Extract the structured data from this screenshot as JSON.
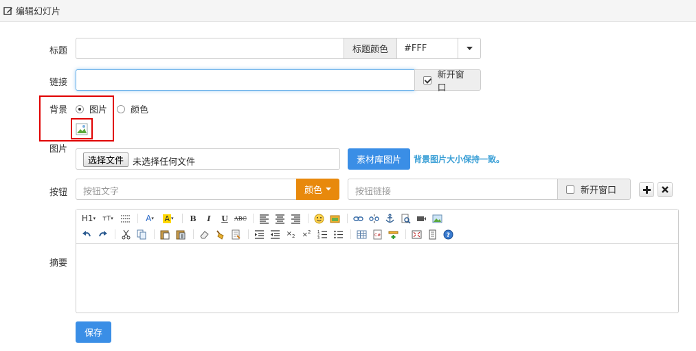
{
  "header": {
    "title": "编辑幻灯片",
    "icon": "edit-icon"
  },
  "title_row": {
    "label": "标题",
    "value": "",
    "color_addon": "标题颜色",
    "color_value": "#FFF"
  },
  "link_row": {
    "label": "链接",
    "value": "",
    "new_window_label": "新开窗口",
    "new_window_checked": true
  },
  "background_row": {
    "label": "背景",
    "options": [
      {
        "label": "图片",
        "selected": true
      },
      {
        "label": "颜色",
        "selected": false
      }
    ],
    "preview_icon": "broken-image-icon"
  },
  "image_row": {
    "label": "图片",
    "choose_file_label": "选择文件",
    "no_file_text": "未选择任何文件",
    "library_button": "素材库图片",
    "hint": "背景图片大小保持一致。"
  },
  "button_row": {
    "label": "按钮",
    "text_placeholder": "按钮文字",
    "color_button": "颜色",
    "link_placeholder": "按钮链接",
    "new_window_label": "新开窗口",
    "new_window_checked": false,
    "add_icon": "plus-icon",
    "remove_icon": "times-icon"
  },
  "summary_row": {
    "label": "摘要",
    "toolbar": {
      "row1": [
        "H1",
        "tT",
        "line-height",
        "font-color",
        "highlight",
        "B",
        "I",
        "U",
        "ABC",
        "align-left",
        "align-center",
        "align-right",
        "emoticon",
        "insert-image-folder",
        "link",
        "unlink",
        "anchor",
        "search-replace",
        "video",
        "image"
      ],
      "row2": [
        "undo",
        "redo",
        "cut",
        "copy",
        "paste",
        "paste-text",
        "eraser",
        "format-brush",
        "paste-word",
        "indent",
        "outdent",
        "subscript",
        "superscript",
        "ordered-list",
        "unordered-list",
        "table",
        "code",
        "insert-row",
        "fullscreen",
        "preview",
        "help"
      ]
    }
  },
  "save_button": "保存",
  "colors": {
    "primary": "#337ab7",
    "blue_btn": "#3a8ee6",
    "orange": "#e8890c",
    "hint": "#3a9fd6",
    "highlight_box": "#e00000"
  }
}
